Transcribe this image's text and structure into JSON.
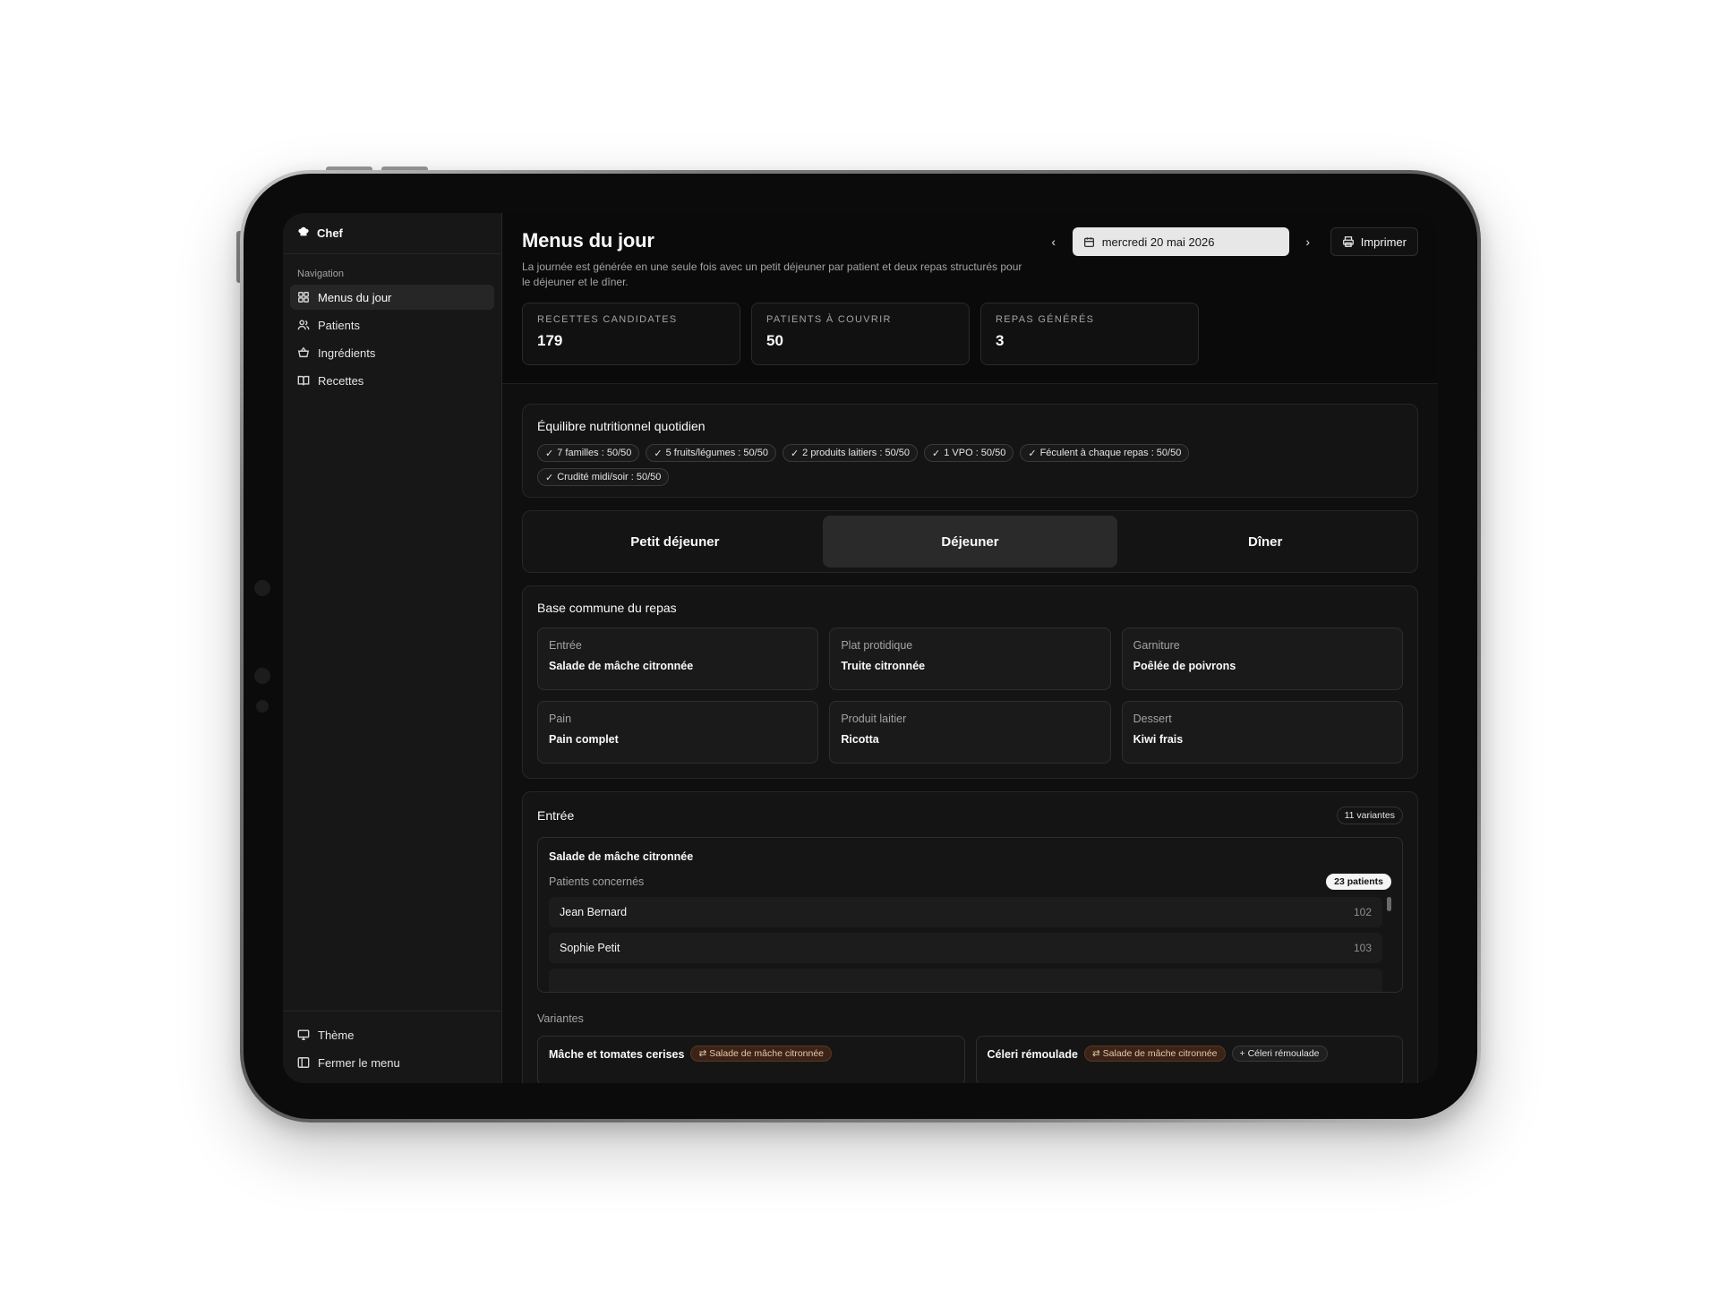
{
  "app": {
    "brand": "Chef"
  },
  "sidebar": {
    "section_label": "Navigation",
    "items": [
      {
        "label": "Menus du jour",
        "icon": "grid-icon"
      },
      {
        "label": "Patients",
        "icon": "users-icon"
      },
      {
        "label": "Ingrédients",
        "icon": "basket-icon"
      },
      {
        "label": "Recettes",
        "icon": "book-icon"
      }
    ],
    "footer": [
      {
        "label": "Thème",
        "icon": "monitor-icon"
      },
      {
        "label": "Fermer le menu",
        "icon": "sidebar-icon"
      }
    ]
  },
  "header": {
    "title": "Menus du jour",
    "subtitle": "La journée est générée en une seule fois avec un petit déjeuner par patient et deux repas structurés pour le déjeuner et le dîner.",
    "date": "mercredi 20 mai 2026",
    "print_label": "Imprimer"
  },
  "stats": [
    {
      "label": "RECETTES CANDIDATES",
      "value": "179"
    },
    {
      "label": "PATIENTS À COUVRIR",
      "value": "50"
    },
    {
      "label": "REPAS GÉNÉRÉS",
      "value": "3"
    }
  ],
  "nutrition": {
    "title": "Équilibre nutritionnel quotidien",
    "chips": [
      "7 familles : 50/50",
      "5 fruits/légumes : 50/50",
      "2 produits laitiers : 50/50",
      "1 VPO : 50/50",
      "Féculent à chaque repas : 50/50",
      "Crudité midi/soir : 50/50"
    ]
  },
  "tabs": [
    {
      "label": "Petit déjeuner"
    },
    {
      "label": "Déjeuner"
    },
    {
      "label": "Dîner"
    }
  ],
  "base": {
    "title": "Base commune du repas",
    "cells": [
      {
        "label": "Entrée",
        "value": "Salade de mâche citronnée"
      },
      {
        "label": "Plat protidique",
        "value": "Truite citronnée"
      },
      {
        "label": "Garniture",
        "value": "Poêlée de poivrons"
      },
      {
        "label": "Pain",
        "value": "Pain complet"
      },
      {
        "label": "Produit laitier",
        "value": "Ricotta"
      },
      {
        "label": "Dessert",
        "value": "Kiwi frais"
      }
    ]
  },
  "entree": {
    "title": "Entrée",
    "variants_badge": "11 variantes",
    "dish": "Salade de mâche citronnée",
    "patients_label": "Patients concernés",
    "patients_badge": "23 patients",
    "patients": [
      {
        "name": "Jean Bernard",
        "room": "102"
      },
      {
        "name": "Sophie Petit",
        "room": "103"
      }
    ],
    "variants_label": "Variantes",
    "variants": [
      {
        "name": "Mâche et tomates cerises",
        "swap": "Salade de mâche citronnée"
      },
      {
        "name": "Céleri rémoulade",
        "swap": "Salade de mâche citronnée",
        "add": "Céleri rémoulade"
      }
    ]
  }
}
